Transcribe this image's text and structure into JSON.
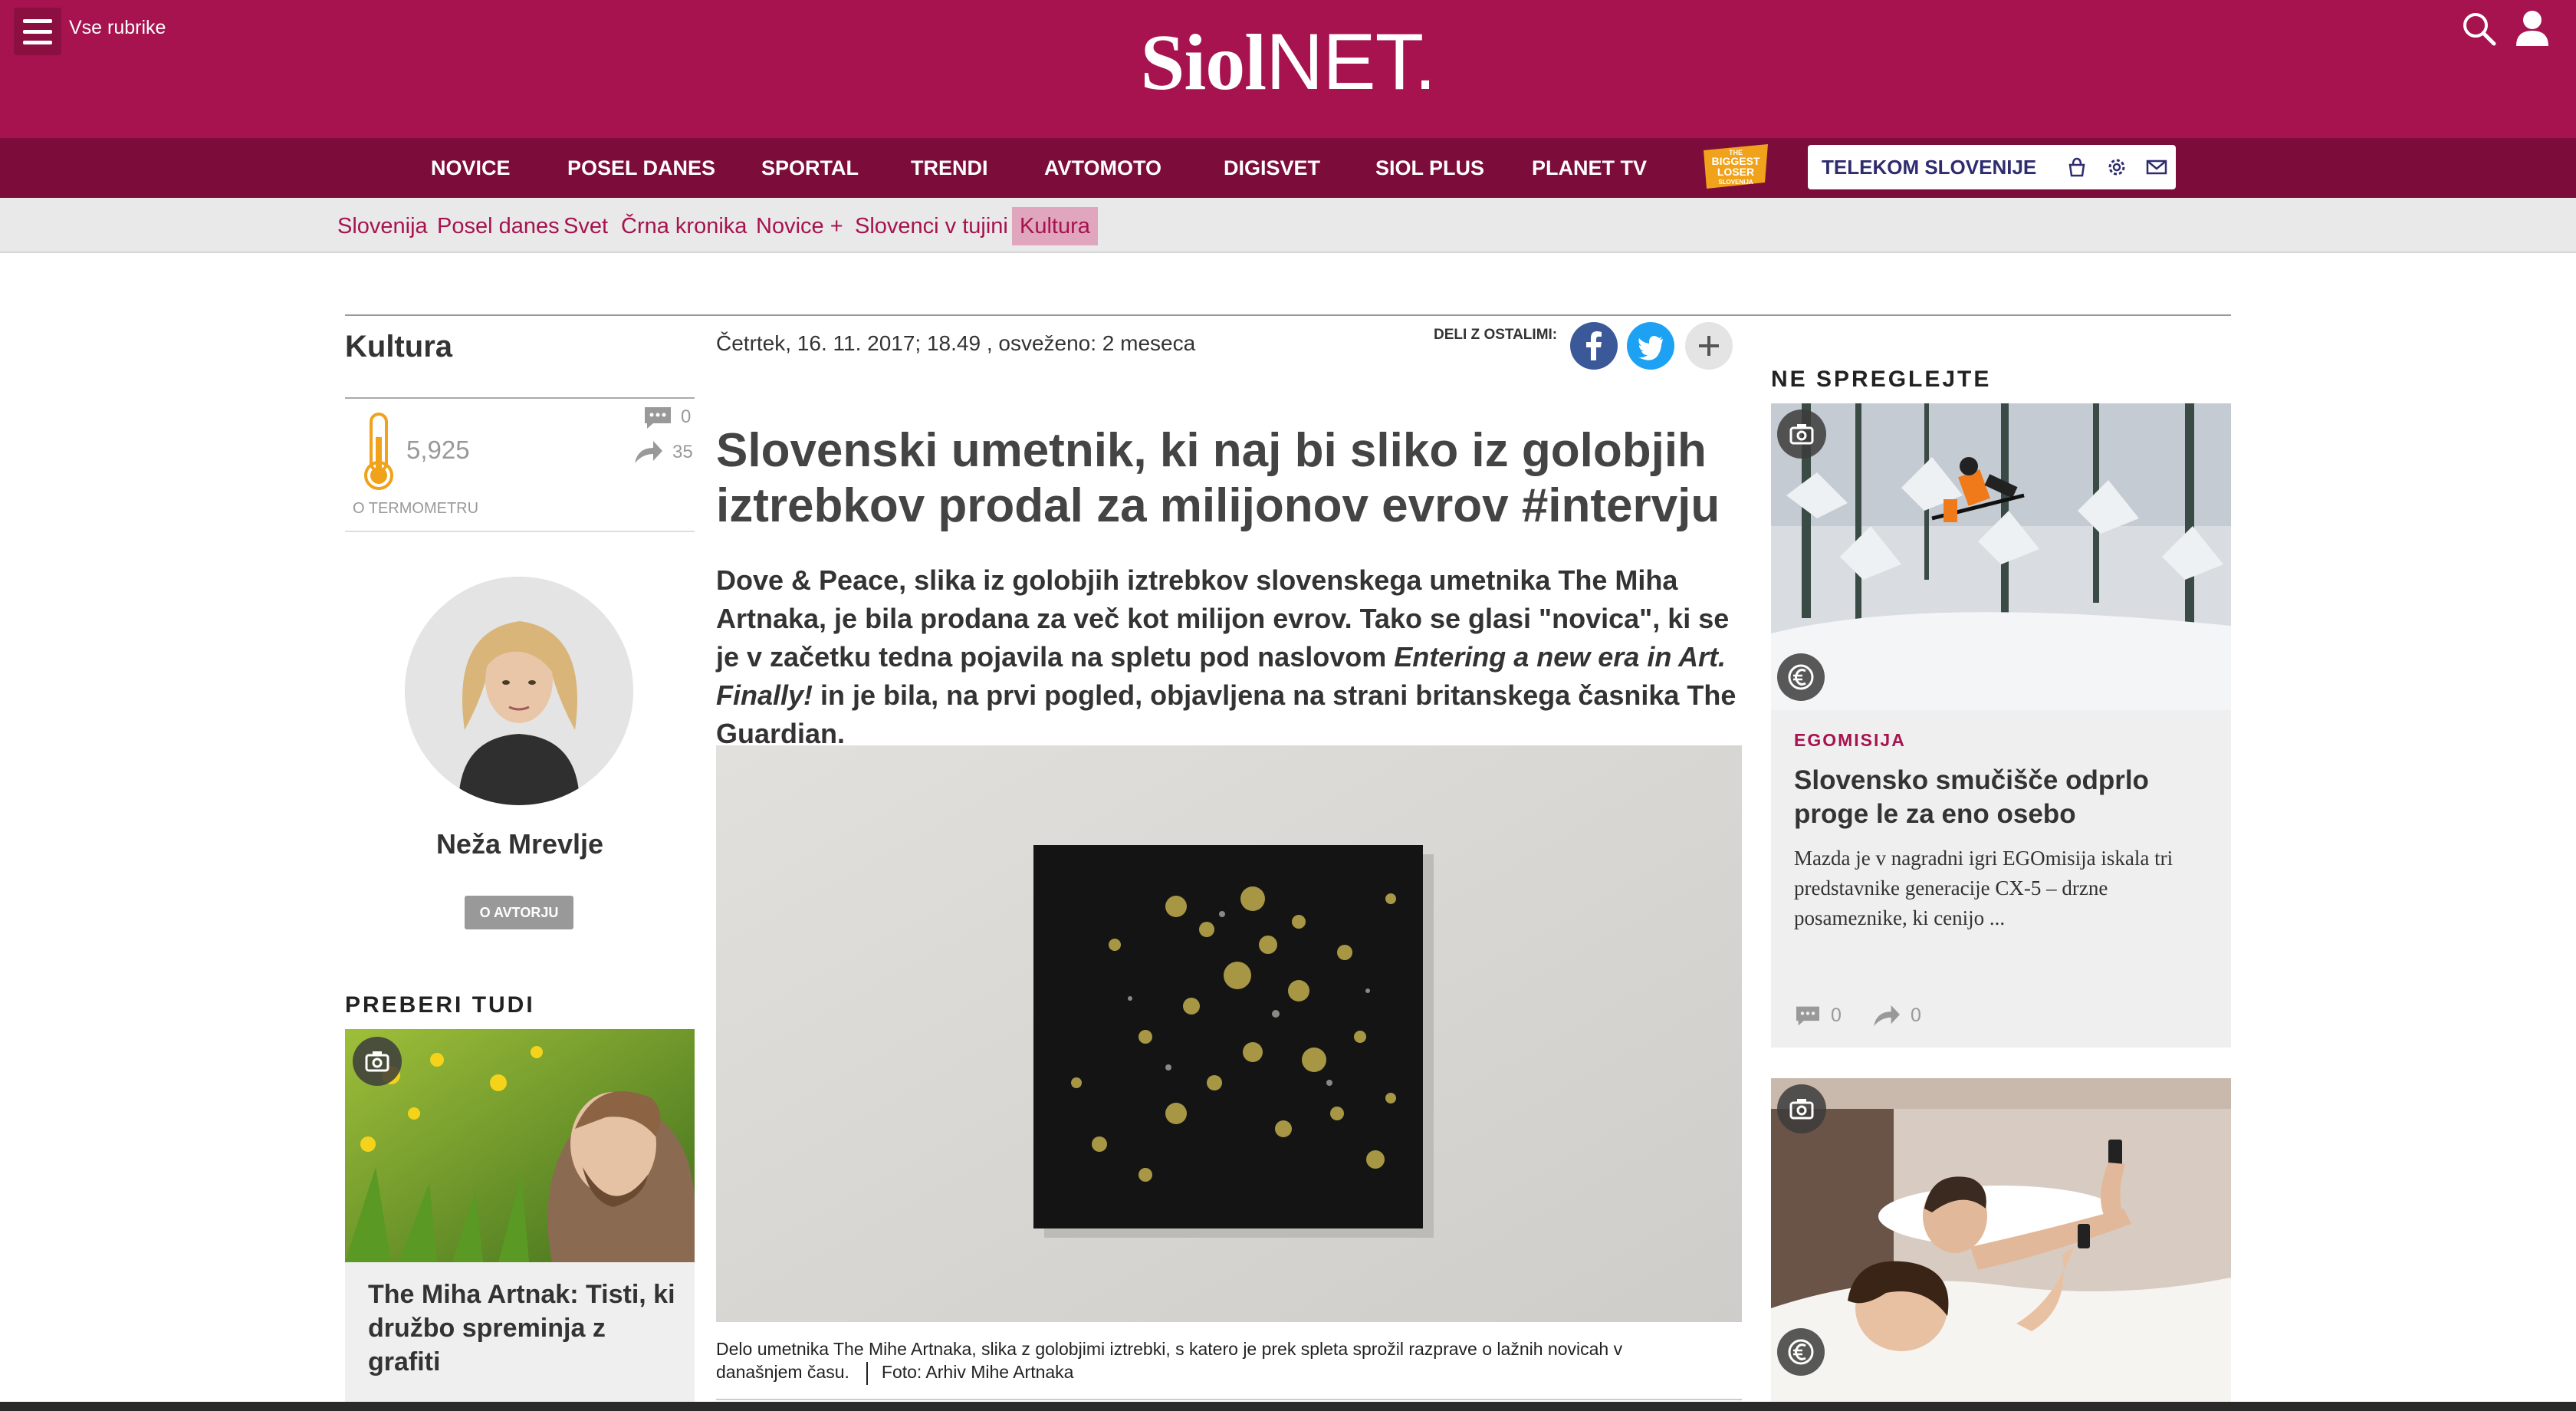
{
  "header": {
    "menu_label": "Vse rubrike",
    "logo_bold": "Siol",
    "logo_light": "NET.",
    "brand_color": "#a6134f",
    "nav_color": "#7c0c39"
  },
  "main_nav": {
    "items": [
      "NOVICE",
      "POSEL DANES",
      "SPORTAL",
      "TRENDI",
      "AVTOMOTO",
      "DIGISVET",
      "SIOL PLUS",
      "PLANET TV"
    ],
    "promo_logo_text": [
      "THE",
      "BIGGEST",
      "LOSER",
      "SLOVENIJA"
    ],
    "telekom_label": "TELEKOM SLOVENIJE"
  },
  "sub_nav": {
    "items": [
      "Slovenija",
      "Posel danes",
      "Svet",
      "Črna kronika",
      "Novice +",
      "Slovenci v tujini",
      "Kultura"
    ],
    "active": "Kultura"
  },
  "left": {
    "section": "Kultura",
    "thermometer_value": "5,925",
    "comments": "0",
    "shares": "35",
    "thermometer_link": "O TERMOMETRU",
    "author_name": "Neža Mrevlje",
    "author_button": "O AVTORJU",
    "read_also_title": "PREBERI TUDI",
    "read_also_headline": "The Miha Artnak: Tisti, ki družbo spreminja z grafiti"
  },
  "article": {
    "date": "Četrtek, 16. 11. 2017; 18.49 , osveženo: 2 meseca",
    "share_label": "DELI Z OSTALIMI:",
    "headline": "Slovenski umetnik, ki naj bi sliko iz golobjih iztrebkov prodal za milijonov evrov #intervju",
    "lead_part1": "Dove & Peace, slika iz golobjih iztrebkov slovenskega umetnika The Miha Artnaka, je bila prodana za več kot milijon evrov. Tako se glasi \"novica\", ki se je v začetku tedna pojavila na spletu pod naslovom ",
    "lead_italic": "Entering a new era in Art. Finally!",
    "lead_part2": " in je bila, na prvi pogled, objavljena na strani britanskega časnika The Guardian.",
    "caption": "Delo umetnika The Mihe Artnaka, slika z golobjimi iztrebki, s katero je prek spleta sprožil razprave o lažnih novicah v današnjem času.",
    "photo_credit": "Foto: Arhiv Mihe Artnaka"
  },
  "right": {
    "title": "NE SPREGLEJTE",
    "card1": {
      "category": "EGOMISIJA",
      "headline": "Slovensko smučišče odprlo proge le za eno osebo",
      "text": "Mazda je v nagradni igri EGOmisija iskala tri predstavnike generacije CX-5 – drzne posameznike, ki cenijo ...",
      "comments": "0",
      "shares": "0"
    }
  }
}
